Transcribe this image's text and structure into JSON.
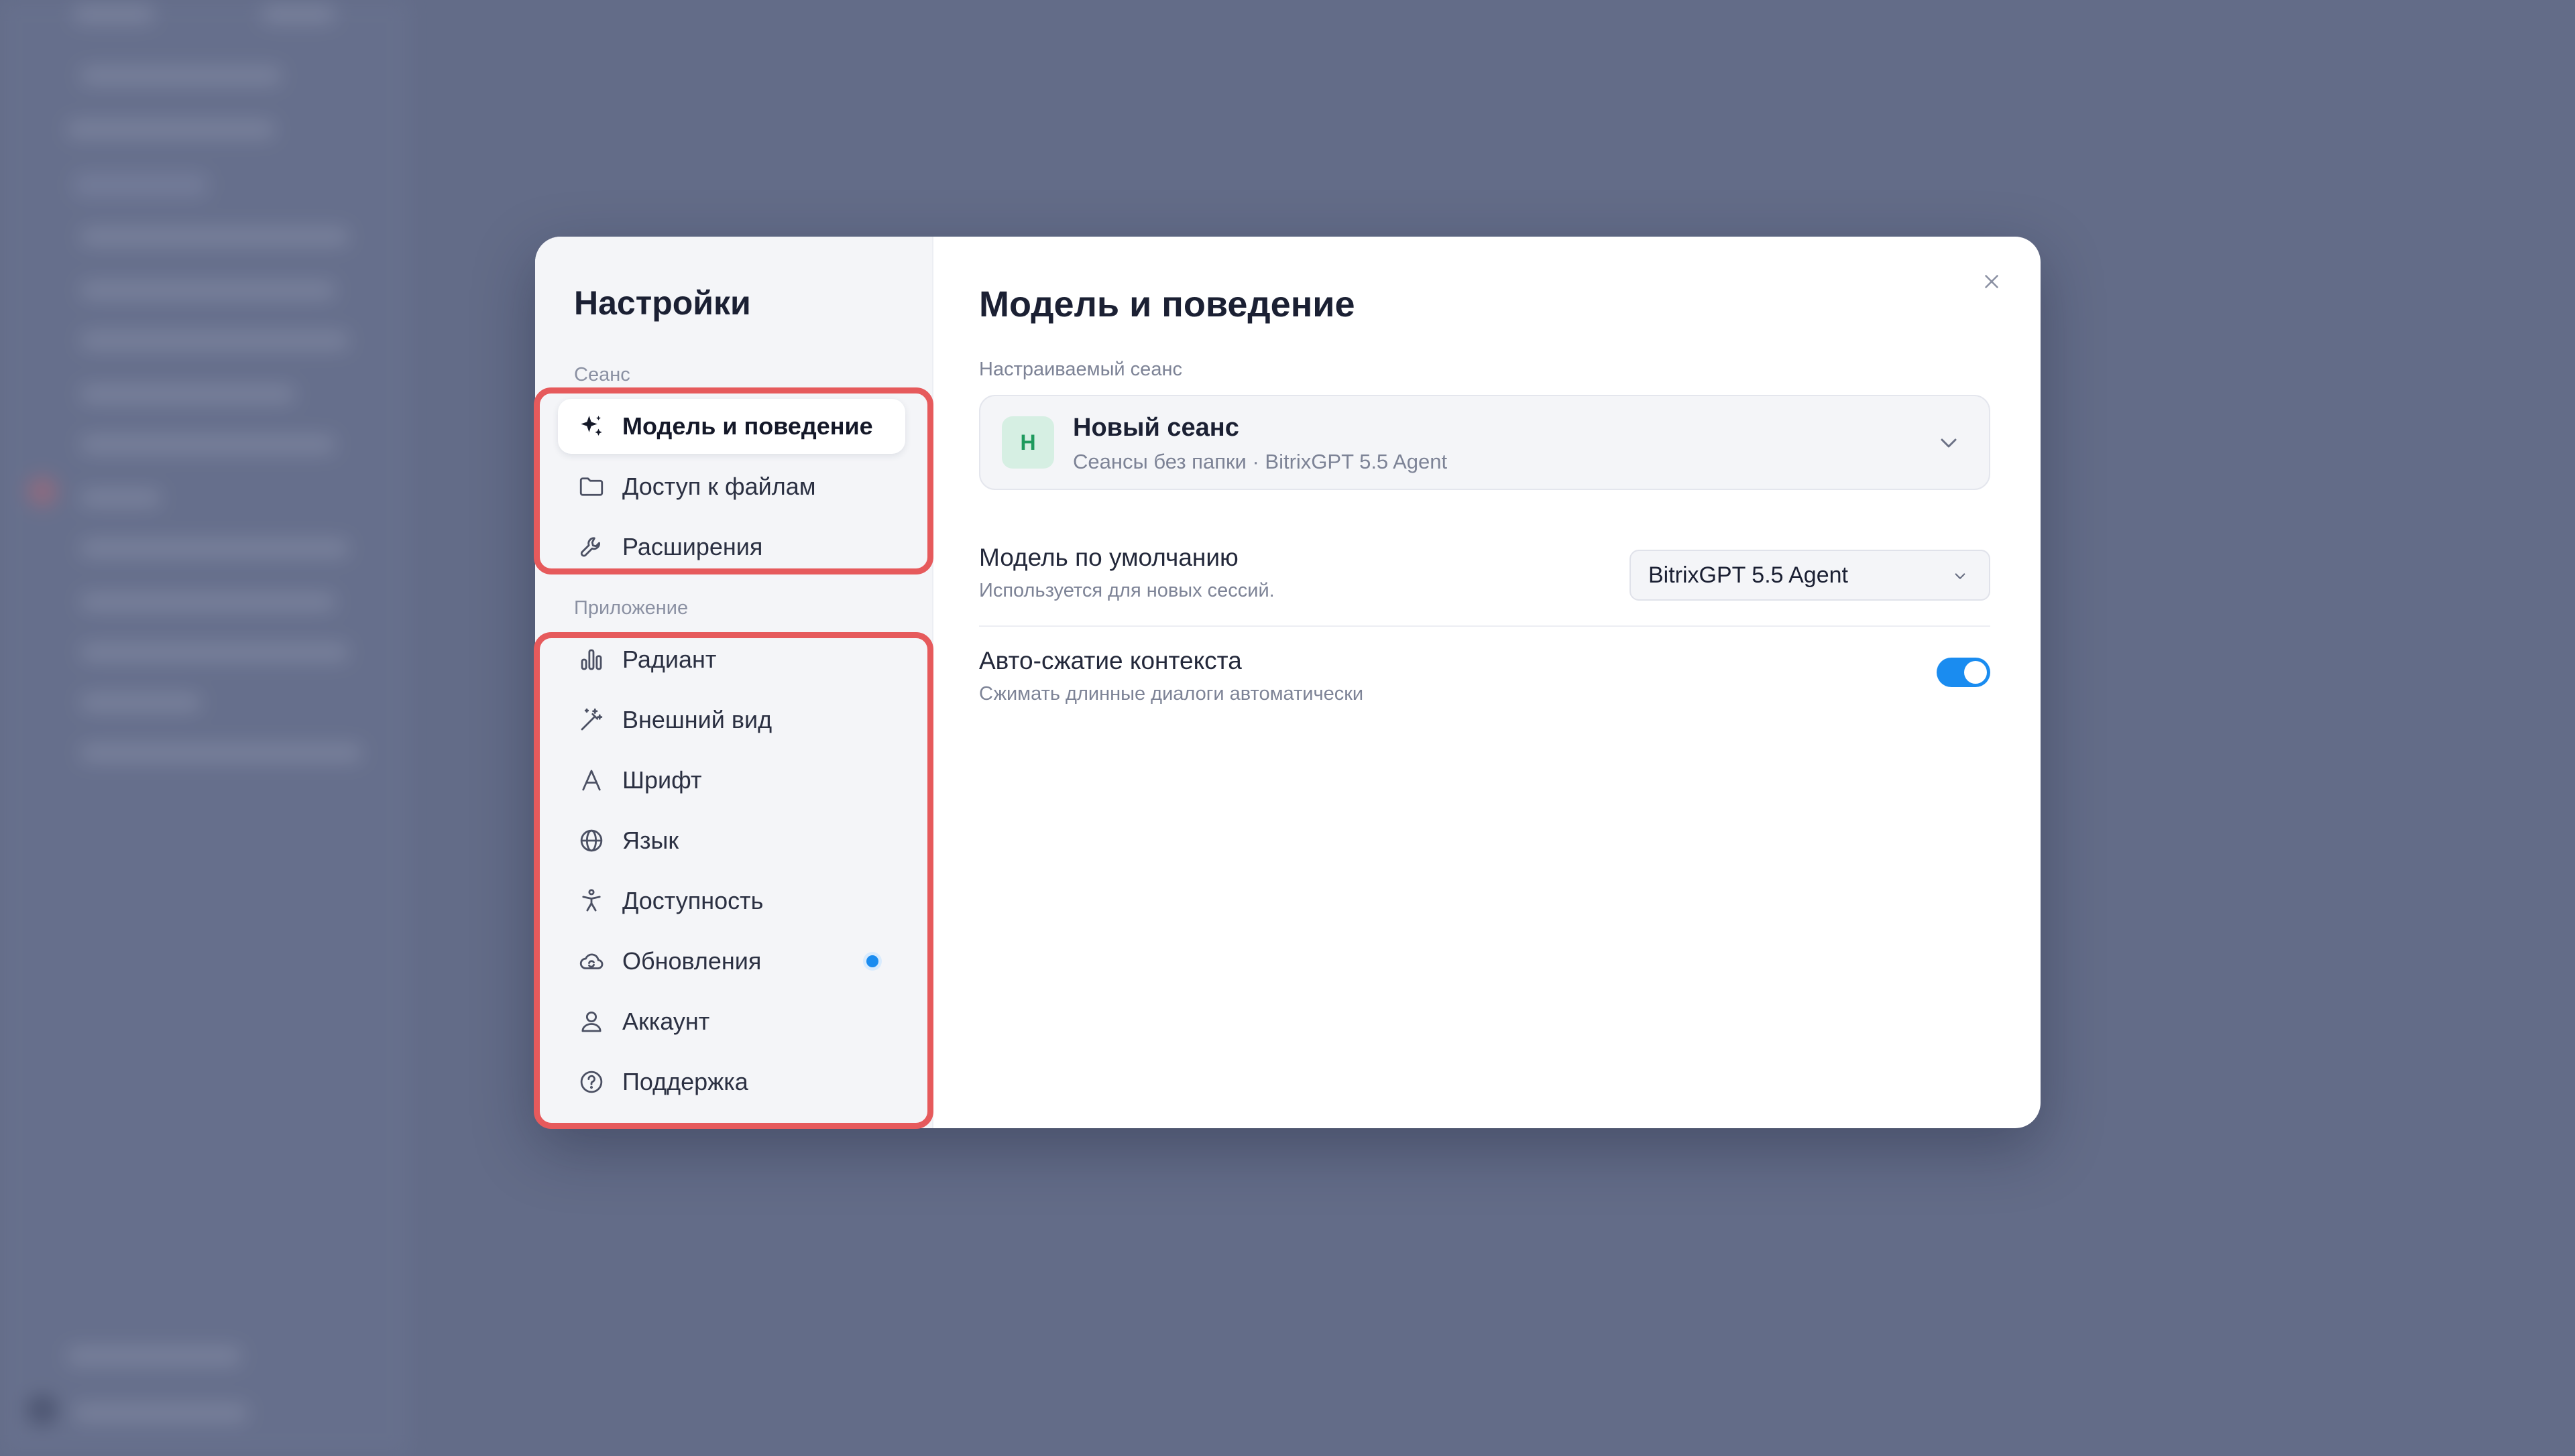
{
  "nav": {
    "title": "Настройки",
    "sections": [
      {
        "label": "Сеанс",
        "items": [
          {
            "label": "Модель и поведение",
            "icon": "sparkle-icon",
            "active": true
          },
          {
            "label": "Доступ к файлам",
            "icon": "folder-icon"
          },
          {
            "label": "Расширения",
            "icon": "wrench-icon"
          }
        ]
      },
      {
        "label": "Приложение",
        "items": [
          {
            "label": "Радиант",
            "icon": "bar-chart-icon"
          },
          {
            "label": "Внешний вид",
            "icon": "magic-wand-icon"
          },
          {
            "label": "Шрифт",
            "icon": "font-icon"
          },
          {
            "label": "Язык",
            "icon": "globe-icon"
          },
          {
            "label": "Доступность",
            "icon": "accessibility-icon"
          },
          {
            "label": "Обновления",
            "icon": "cloud-sync-icon",
            "badge": true
          },
          {
            "label": "Аккаунт",
            "icon": "user-icon"
          },
          {
            "label": "Поддержка",
            "icon": "help-circle-icon"
          }
        ]
      }
    ]
  },
  "content": {
    "title": "Модель и поведение",
    "session_label": "Настраиваемый сеанс",
    "session": {
      "avatar": "Н",
      "name": "Новый сеанс",
      "meta": "Сеансы без папки · BitrixGPT 5.5 Agent"
    },
    "default_model": {
      "title": "Модель по умолчанию",
      "desc": "Используется для новых сессий.",
      "value": "BitrixGPT 5.5 Agent"
    },
    "auto_compress": {
      "title": "Авто-сжатие контекста",
      "desc": "Сжимать длинные диалоги автоматически",
      "enabled": true
    }
  },
  "colors": {
    "accent": "#1a8cf0",
    "highlight": "#e65a5c",
    "overlay": "#636c88"
  }
}
